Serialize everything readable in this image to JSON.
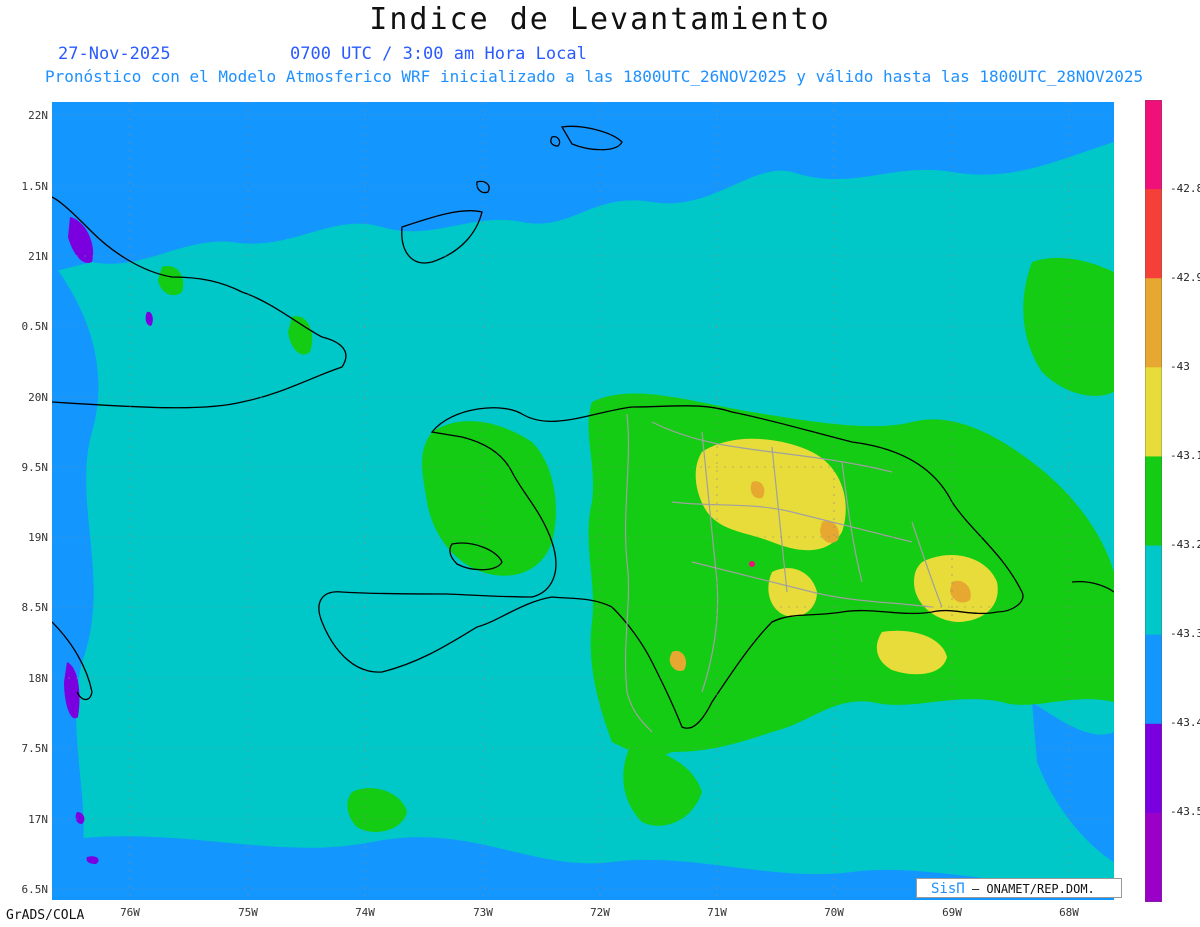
{
  "header": {
    "title": "Indice de Levantamiento",
    "date": "27-Nov-2025",
    "valid_time": "0700 UTC / 3:00 am Hora Local",
    "model_info": "Pronóstico con el Modelo Atmosferico WRF inicializado a las 1800UTC_26NOV2025 y válido hasta las  1800UTC_28NOV2025"
  },
  "axes": {
    "lat_ticks": [
      "22N",
      "1.5N",
      "21N",
      "0.5N",
      "20N",
      "9.5N",
      "19N",
      "8.5N",
      "18N",
      "7.5N",
      "17N",
      "6.5N"
    ],
    "lon_ticks": [
      "76W",
      "75W",
      "74W",
      "73W",
      "72W",
      "71W",
      "70W",
      "69W",
      "68W"
    ]
  },
  "legend": {
    "labels": [
      "-42.8",
      "-42.9",
      "-43",
      "-43.1",
      "-43.2",
      "-43.3",
      "-43.4",
      "-43.5"
    ],
    "colors": [
      "#f0107a",
      "#f5403a",
      "#e6a830",
      "#e8dc3a",
      "#14cc14",
      "#00c8c8",
      "#1496ff",
      "#7a00e0",
      "#9a00c8"
    ]
  },
  "credit": {
    "brand": "SisΠ",
    "org": "– ONAMET/REP.DOM."
  },
  "footer": {
    "software": "GrADS/COLA"
  }
}
